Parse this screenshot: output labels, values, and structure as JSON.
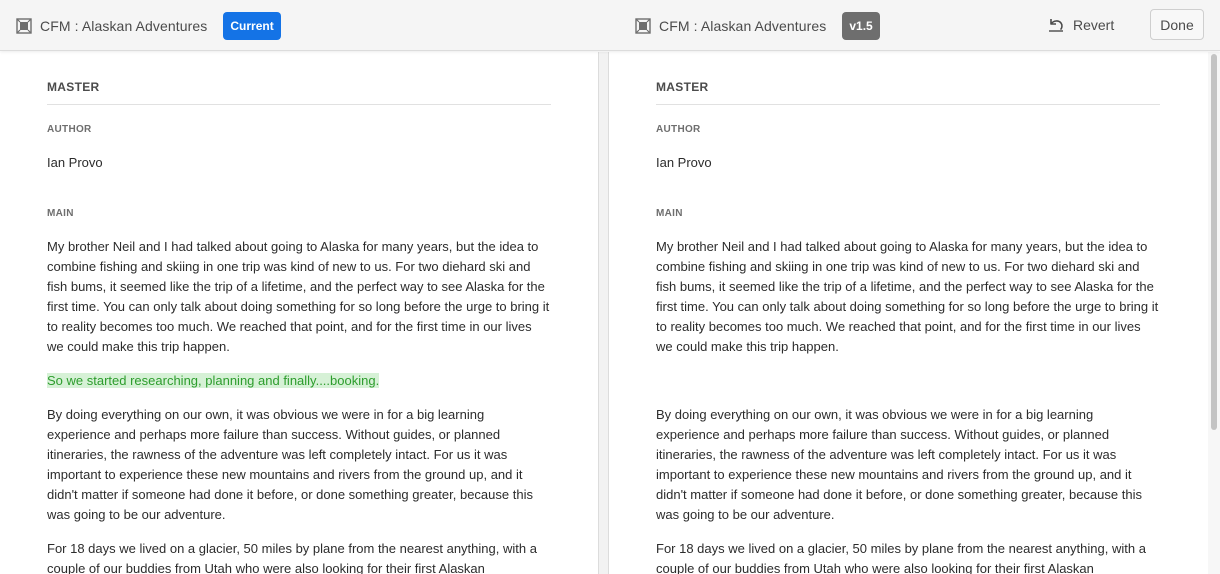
{
  "header": {
    "left": {
      "title": "CFM : Alaskan Adventures",
      "badge": "Current"
    },
    "right": {
      "title": "CFM : Alaskan Adventures",
      "badge": "v1.5"
    },
    "revert_label": "Revert",
    "done_label": "Done"
  },
  "section_title": "MASTER",
  "fields": {
    "author_label": "AUTHOR",
    "author_value": "Ian Provo",
    "main_label": "MAIN"
  },
  "paragraphs": {
    "p1": "My brother Neil and I had talked about going to Alaska for many years, but the idea to combine fishing and skiing in one trip was kind of new to us. For two diehard ski and fish bums, it seemed like the trip of a lifetime, and the perfect way to see Alaska for the first time. You can only talk about doing something for so long before the urge to bring it to reality becomes too much. We reached that point, and for the first time in our lives we could make this trip happen.",
    "added": "So we started researching, planning and finally....booking.",
    "p2": "By doing everything on our own, it was obvious we were in for a big learning experience and perhaps more failure than success. Without guides, or planned itineraries, the rawness of the adventure was left completely intact. For us it was important to experience these new mountains and rivers from the ground up, and it didn't matter if someone had done it before, or done something greater, because this was going to be our adventure.",
    "p3": "For 18 days we lived on a glacier, 50 miles by plane from the nearest anything, with a couple of our buddies from Utah who were also looking for their first Alaskan"
  },
  "colors": {
    "current_badge": "#1473e6",
    "version_badge": "#6e6e6e",
    "added_highlight_bg": "#d6f1d6",
    "added_highlight_text": "#2d9d2d"
  },
  "icons": {
    "fragment": "content-fragment-icon",
    "revert": "undo-icon"
  }
}
